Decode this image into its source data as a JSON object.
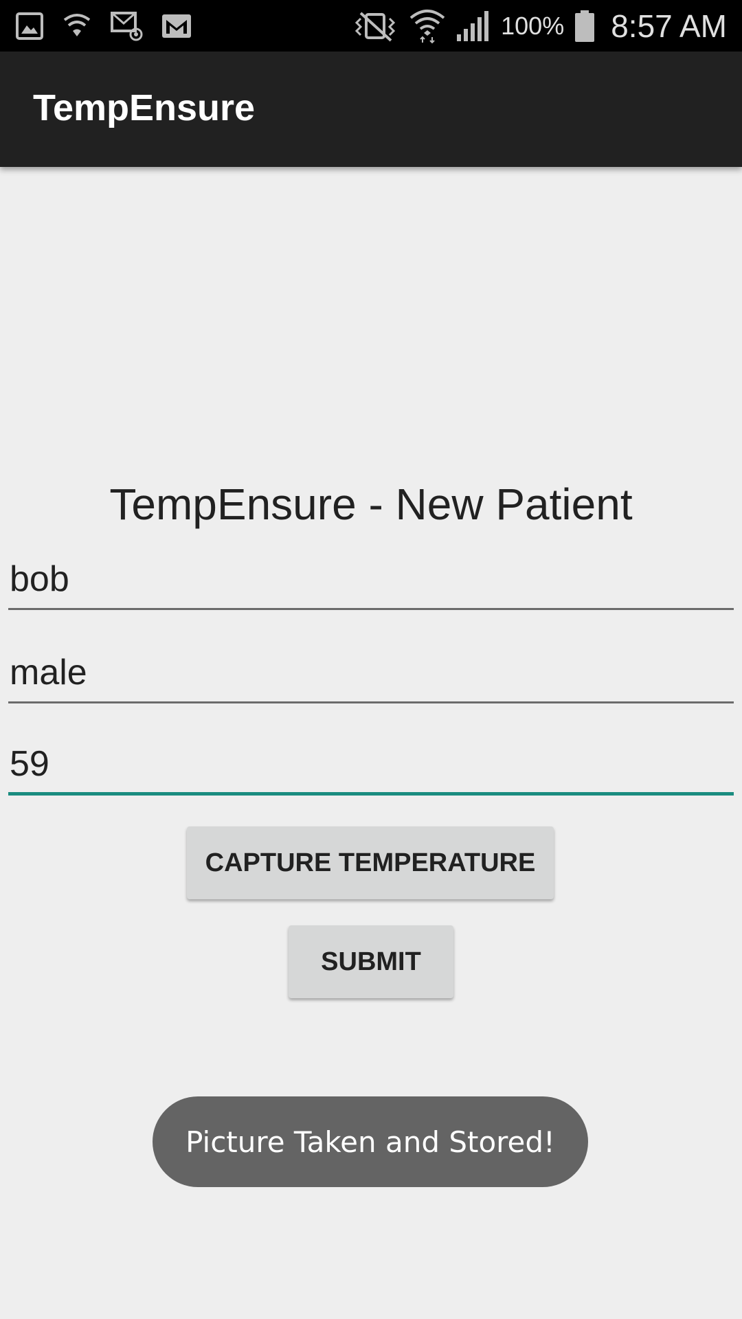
{
  "status_bar": {
    "battery_text": "100%",
    "time": "8:57 AM",
    "left_icons": [
      "gallery-icon",
      "wifi-shield-icon",
      "email-icon",
      "gmail-icon"
    ],
    "right_icons": [
      "vibrate-mute-icon",
      "wifi-icon",
      "signal-icon",
      "battery-icon"
    ]
  },
  "app_bar": {
    "title": "TempEnsure"
  },
  "form": {
    "title": "TempEnsure - New Patient",
    "name_value": "bob",
    "gender_value": "male",
    "age_value": "59",
    "capture_label": "CAPTURE TEMPERATURE",
    "submit_label": "SUBMIT"
  },
  "toast": {
    "message": "Picture Taken and Stored!"
  },
  "colors": {
    "status_bar": "#000000",
    "app_bar": "#212121",
    "background": "#eeeeee",
    "focused_underline": "#1a8c80",
    "button": "#d6d7d7",
    "toast": "#646464"
  }
}
